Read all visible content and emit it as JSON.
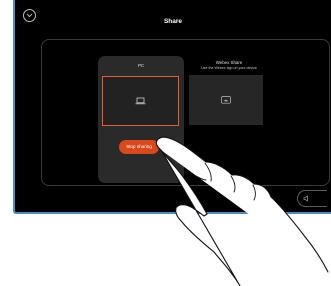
{
  "header": {
    "title": "Share"
  },
  "sources": {
    "pc": {
      "label": "PC",
      "stop_label": "Stop sharing"
    },
    "webex": {
      "label": "Webex Share",
      "description": "Use the Webex app on your device"
    }
  },
  "icons": {
    "back": "chevron-down-icon",
    "pc_preview": "laptop-icon",
    "webex_preview": "cast-icon",
    "sound": "speaker-icon"
  },
  "colors": {
    "screen_background": "#000000",
    "accent": "#f05a22",
    "stop_button": "#d9491c",
    "card_background": "#2a2a2a"
  }
}
